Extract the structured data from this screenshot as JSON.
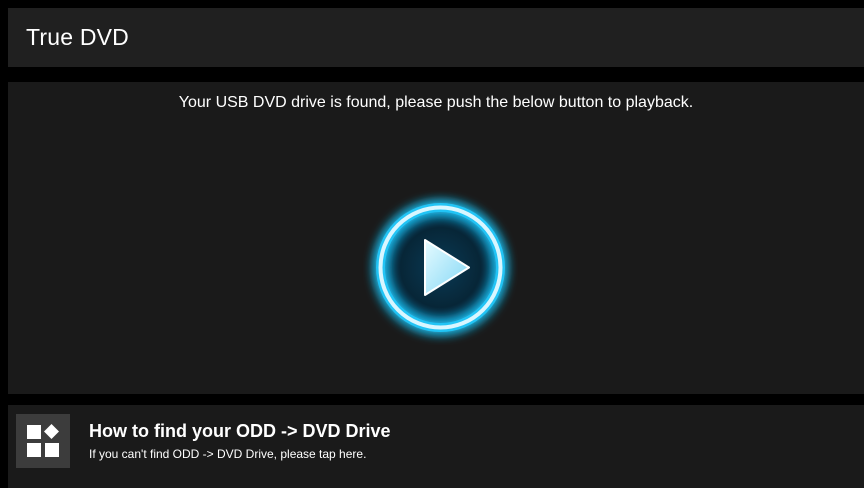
{
  "app_bar": {
    "title": "True DVD"
  },
  "main": {
    "message": "Your USB DVD drive is found, please push the below button to playback.",
    "play_button_icon": "play-icon"
  },
  "help": {
    "icon": "apps-grid-icon",
    "title": "How to find your ODD -> DVD Drive",
    "subtitle": "If you can't find ODD -> DVD Drive, please tap here."
  },
  "colors": {
    "app_bar_bg": "#202020",
    "panel_bg": "#1a1a1a",
    "glow_accent": "#19b9f0",
    "text": "#ffffff"
  }
}
